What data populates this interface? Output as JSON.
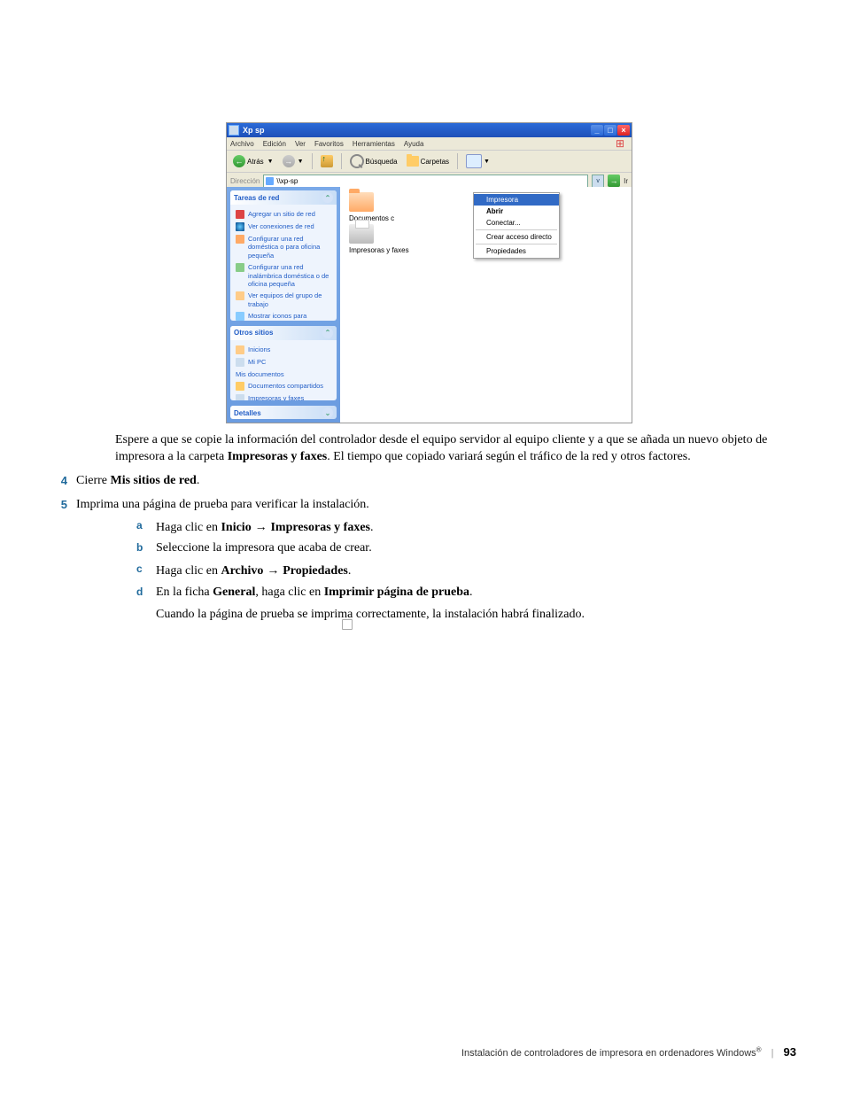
{
  "screenshot": {
    "title": "Xp sp",
    "menubar": [
      "Archivo",
      "Edición",
      "Ver",
      "Favoritos",
      "Herramientas",
      "Ayuda"
    ],
    "toolbar": {
      "back": "Atrás",
      "search": "Búsqueda",
      "folders": "Carpetas"
    },
    "address": {
      "label": "Dirección",
      "value": "\\\\xp-sp",
      "go": "Ir"
    },
    "panels": {
      "network": {
        "title": "Tareas de red",
        "items": [
          "Agregar un sitio de red",
          "Ver conexiones de red",
          "Configurar una red doméstica o para oficina pequeña",
          "Configurar una red inalámbrica doméstica o de oficina pequeña",
          "Ver equipos del grupo de trabajo",
          "Mostrar iconos para dispositivos UPnP en la red"
        ]
      },
      "other": {
        "title": "Otros sitios",
        "items": [
          "Inicions",
          "Mi PC",
          "Mis documentos",
          "Documentos compartidos",
          "Impresoras y faxes"
        ]
      },
      "details": {
        "title": "Detalles"
      }
    },
    "content": {
      "item1": "Documentos c",
      "item2": "Impresoras y faxes"
    },
    "contextmenu": {
      "selected": "Impresora",
      "items": [
        "Abrir",
        "Conectar...",
        "Crear acceso directo",
        "Propiedades"
      ]
    }
  },
  "doc": {
    "p1a": "Espere a que se copie la información del controlador desde el equipo servidor al equipo cliente y a que se añada un nuevo objeto de impresora a la carpeta ",
    "p1b": "Impresoras y faxes",
    "p1c": ". El tiempo que copiado variará según el tráfico de la red y otros factores.",
    "s4a": "Cierre ",
    "s4b": "Mis sitios de red",
    "s4c": ".",
    "s5": "Imprima una página de prueba para verificar la instalación.",
    "a1": "Haga clic en ",
    "a2": "Inicio",
    "a3": "Impresoras y faxes",
    "b1": "Seleccione la impresora que acaba de crear.",
    "c1": "Haga clic en ",
    "c2": "Archivo",
    "c3": "Propiedades",
    "d1": "En la ficha ",
    "d2": "General",
    "d3": ", haga clic en ",
    "d4": "Imprimir página de prueba",
    "d5": "Cuando la página de prueba se imprima correctamente, la instalación habrá finalizado."
  },
  "footer": {
    "text": "Instalación de controladores de impresora en ordenadores Windows",
    "page": "93"
  }
}
